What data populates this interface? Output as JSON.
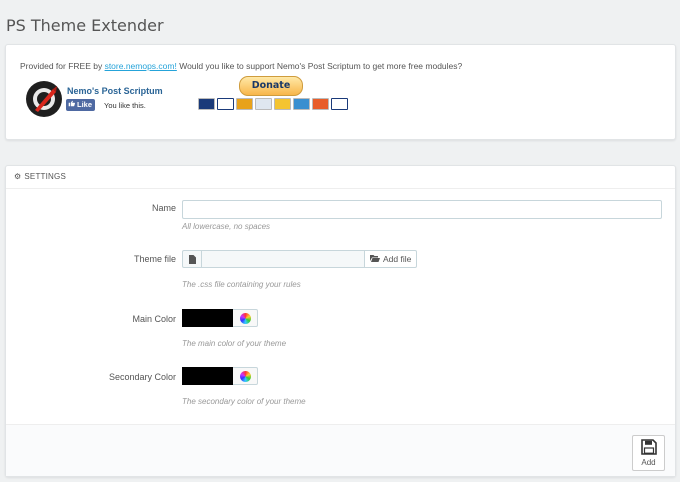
{
  "page_title": "PS Theme Extender",
  "promo": {
    "text_before": "Provided for FREE by ",
    "link_text": "store.nemops.com!",
    "text_after": " Would you like to support Nemo's Post Scriptum to get more free modules?",
    "brand_name": "Nemo's Post Scriptum",
    "like_label": "Like",
    "like_text": "You like this.",
    "donate_label": "Donate",
    "card_colors": [
      "#1a3a7a",
      "#ffffff",
      "#e8a21a",
      "#dfe7f0",
      "#f4c430",
      "#3a8fd0",
      "#e85d2a",
      "#ffffff"
    ]
  },
  "settings": {
    "header": "SETTINGS",
    "name_label": "Name",
    "name_value": "",
    "name_help": "All lowercase, no spaces",
    "theme_file_label": "Theme file",
    "add_file_label": "Add file",
    "theme_file_help": "The .css file containing your rules",
    "main_color_label": "Main Color",
    "main_color_value": "#000000",
    "main_color_help": "The main color of your theme",
    "secondary_color_label": "Secondary Color",
    "secondary_color_value": "#000000",
    "secondary_color_help": "The secondary color of your theme",
    "add_label": "Add"
  }
}
